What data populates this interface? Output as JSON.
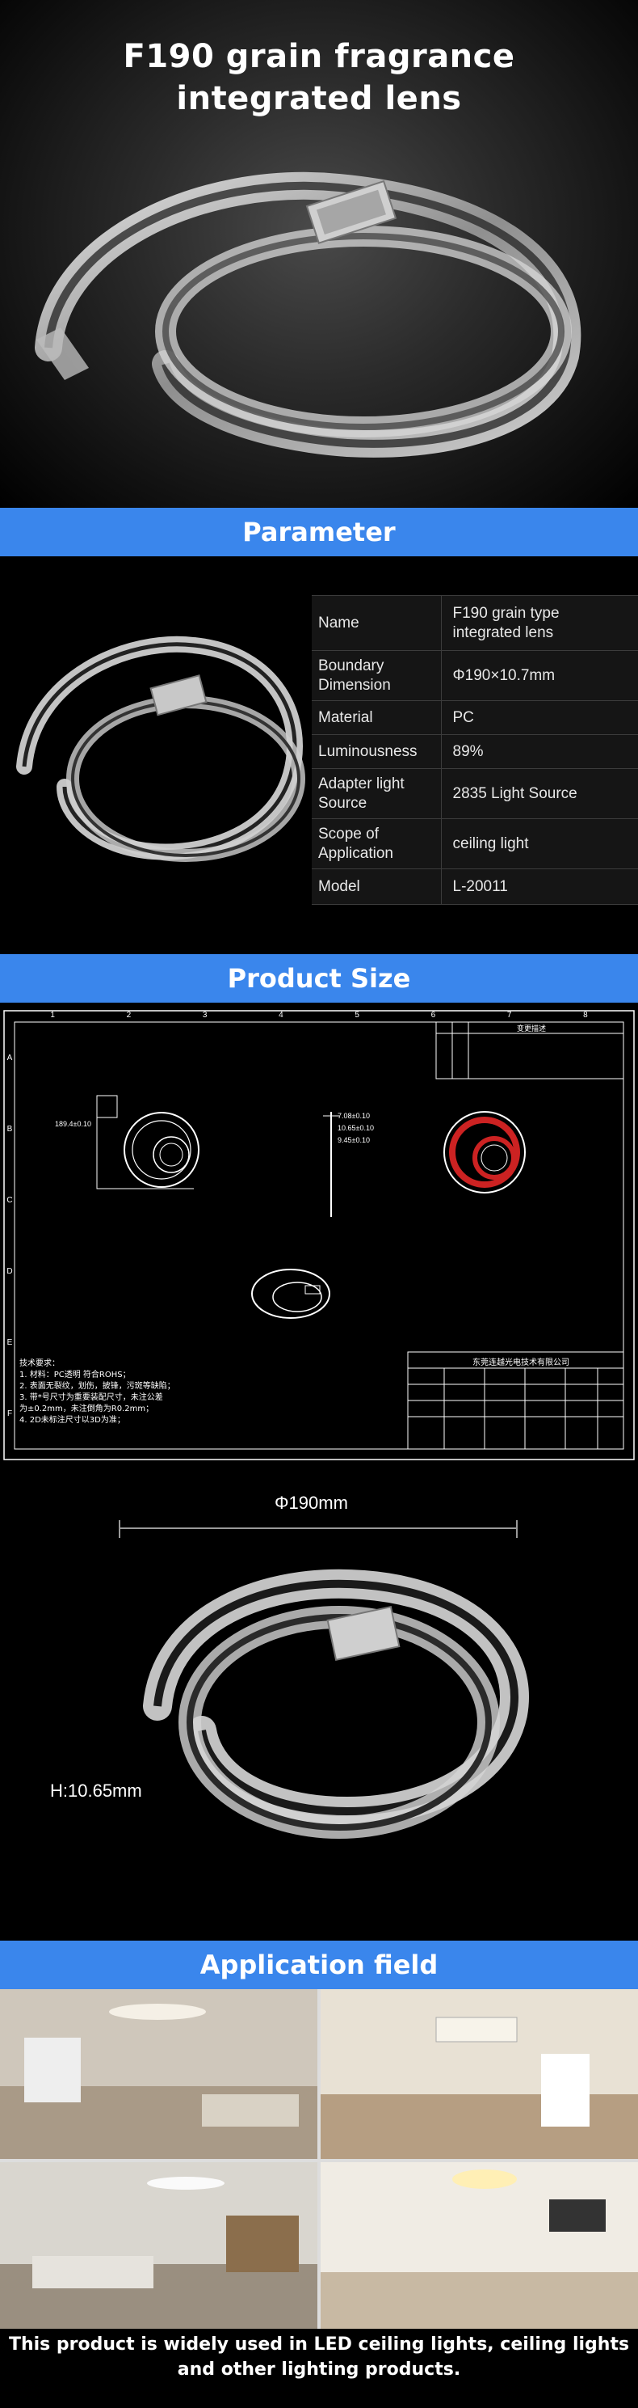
{
  "hero": {
    "title_line1": "F190 grain fragrance",
    "title_line2": "integrated lens"
  },
  "sections": {
    "parameter": "Parameter",
    "product_size": "Product Size",
    "application": "Application field"
  },
  "parameters": [
    {
      "key": "Name",
      "value": "F190 grain type integrated lens"
    },
    {
      "key": "Boundary Dimension",
      "value": "Φ190×10.7mm"
    },
    {
      "key": "Material",
      "value": "PC"
    },
    {
      "key": "Luminousness",
      "value": "89%"
    },
    {
      "key": "Adapter light Source",
      "value": "2835 Light Source"
    },
    {
      "key": "Scope of Application",
      "value": "ceiling light"
    },
    {
      "key": "Model",
      "value": "L-20011"
    }
  ],
  "drawing": {
    "top_numbers": [
      "1",
      "2",
      "3",
      "4",
      "5",
      "6",
      "7",
      "8"
    ],
    "side_letters": [
      "A",
      "B",
      "C",
      "D",
      "E",
      "F"
    ],
    "dim_diameter": "189.4±0.10",
    "dim_h1": "7.08±0.10",
    "dim_h2": "10.65±0.10",
    "dim_h3": "9.45±0.10",
    "revision_header": "变更描述",
    "company": "东莞连越光电技术有限公司",
    "notes": [
      "技术要求：",
      "1. 材料：PC透明    符合ROHS；",
      "2. 表面无裂纹，划伤，披锋，污斑等缺陷；",
      "3. 带*号尺寸为重要装配尺寸，未注公差",
      "   为±0.2mm，未注倒角为R0.2mm；",
      "4. 2D未标注尺寸以3D为准；"
    ]
  },
  "dimensions": {
    "diameter": "Φ190mm",
    "height": "H:10.65mm"
  },
  "footer": {
    "line1": "This product is widely used in LED ceiling lights, ceiling lights",
    "line2": "and other lighting products."
  }
}
